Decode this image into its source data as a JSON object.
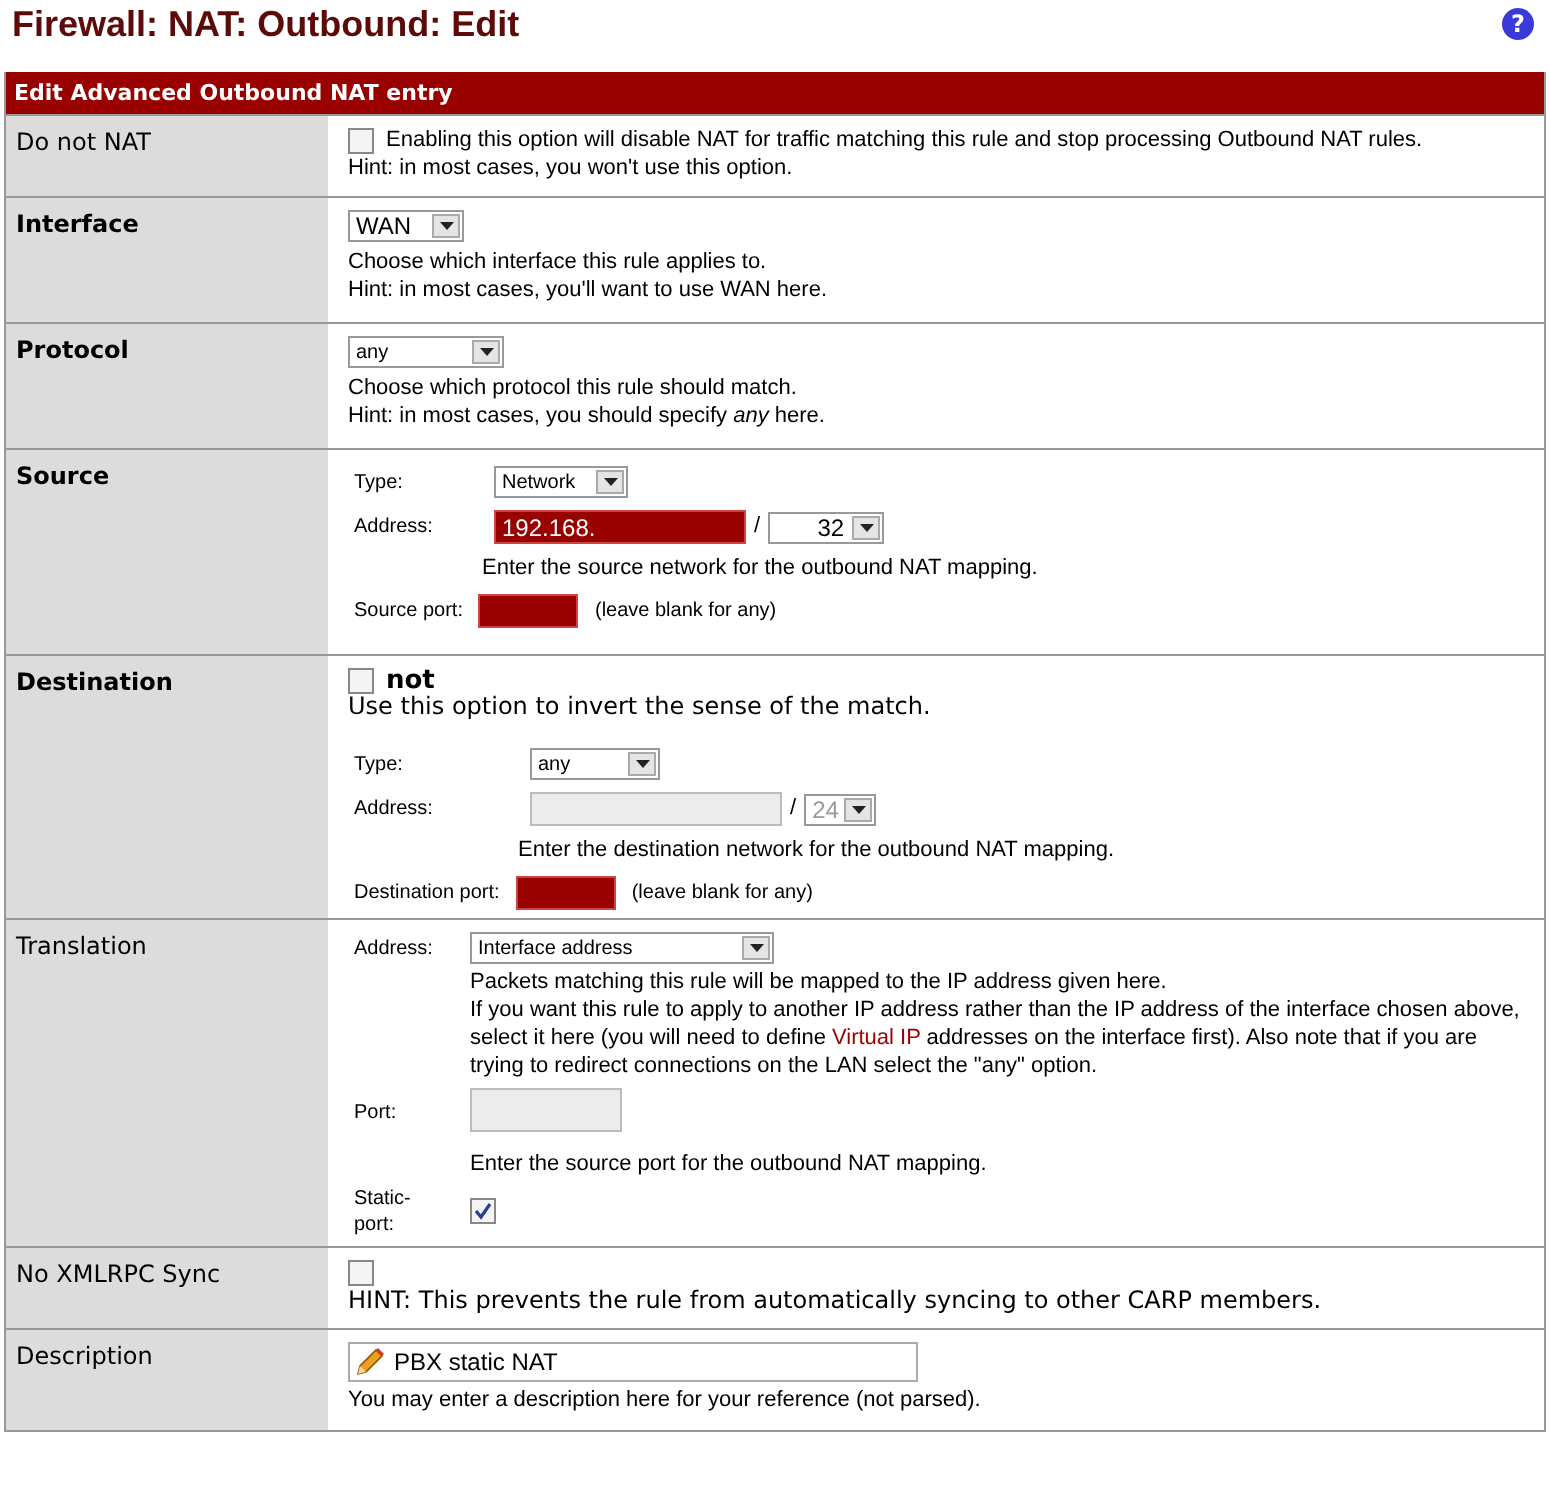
{
  "page": {
    "title": "Firewall: NAT: Outbound: Edit",
    "help_glyph": "?"
  },
  "panel": {
    "title": "Edit Advanced Outbound NAT entry"
  },
  "rows": [
    {
      "kind": "checkbox",
      "label": "Do not NAT",
      "bold": false,
      "checked": false,
      "text": "Enabling this option will disable NAT for traffic matching this rule and stop processing Outbound NAT rules.",
      "help": [
        "Hint: in most cases, you won't use this option."
      ]
    },
    {
      "kind": "select",
      "label": "Interface",
      "bold": true,
      "value": "WAN",
      "help": [
        "Choose which interface this rule applies to.",
        "Hint: in most cases, you'll want to use WAN here."
      ]
    },
    {
      "kind": "select",
      "label": "Protocol",
      "bold": true,
      "value": "any",
      "help": [
        "Choose which protocol this rule should match.",
        "Hint: in most cases, you should specify *any*  here."
      ]
    },
    {
      "kind": "network",
      "label": "Source",
      "bold": true,
      "type_label": "Type:",
      "type_value": "Network",
      "address_label": "Address:",
      "address_value": "192.168.",
      "address_disabled": false,
      "slash": "/",
      "mask": "32",
      "mask_disabled": false,
      "help": "Enter the source network for the outbound NAT mapping.",
      "port_label": "Source port:",
      "port_note": "(leave blank for any)"
    },
    {
      "kind": "network",
      "label": "Destination",
      "bold": true,
      "invert": {
        "checked": false,
        "label": "not",
        "help": "Use this option to invert the sense of the match."
      },
      "type_label": "Type:",
      "type_value": "any",
      "address_label": "Address:",
      "address_value": "",
      "address_disabled": true,
      "slash": "/",
      "mask": "24",
      "mask_disabled": true,
      "help": "Enter the destination network for the outbound NAT mapping.",
      "port_label": "Destination port:",
      "port_note": "(leave blank for any)"
    },
    {
      "kind": "translation",
      "label": "Translation",
      "bold": false,
      "address_label": "Address:",
      "address_value": "Interface address",
      "help": "Packets matching this rule will be mapped to the IP address given here.",
      "note_before": "If you want this rule to apply to another IP address rather than the IP address of the interface chosen above, select it here (you will need to define ",
      "link": "Virtual IP",
      "note_after": " addresses on the interface first). Also note that if you are trying to redirect connections on the LAN select the \"any\" option.",
      "port_label": "Port:",
      "port_help": "Enter the source port for the outbound NAT mapping.",
      "static_label": "Static-port:",
      "static_checked": true
    },
    {
      "kind": "checkbox",
      "label": "No XMLRPC Sync",
      "bold": false,
      "checked": false,
      "text": "",
      "help": [
        "HINT: This prevents the rule from automatically syncing to other CARP members."
      ],
      "large": true
    },
    {
      "kind": "text",
      "label": "Description",
      "bold": false,
      "value": "PBX static NAT",
      "help": [
        "You may enter a description here for your reference (not parsed)."
      ]
    }
  ]
}
